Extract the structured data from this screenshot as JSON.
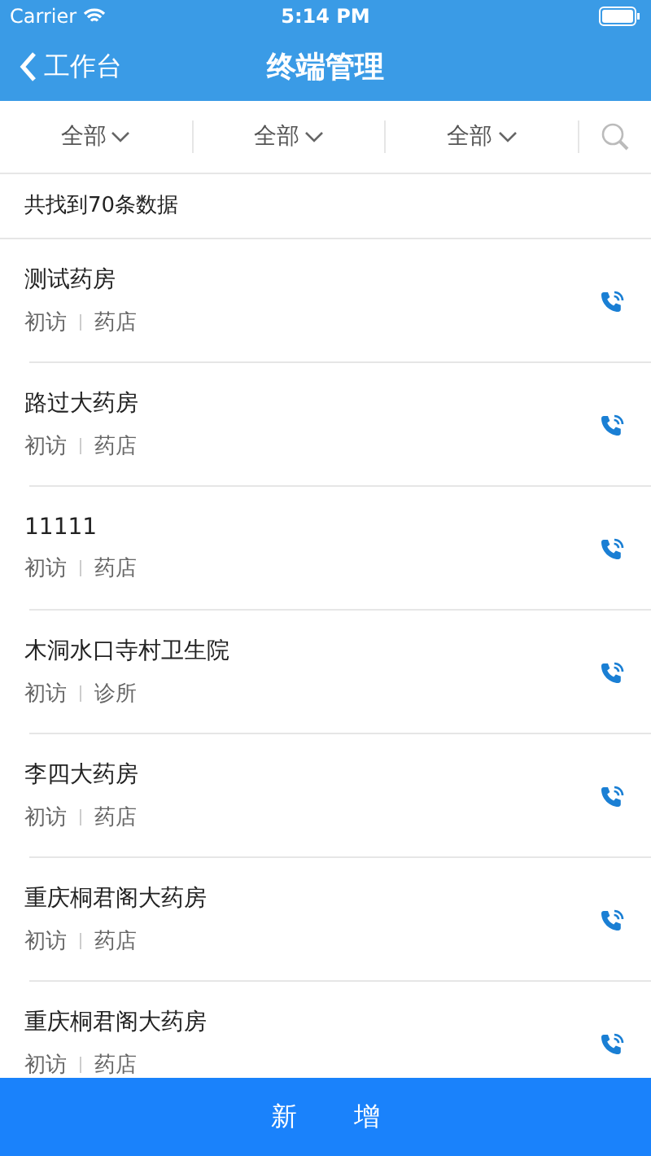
{
  "status_bar": {
    "carrier": "Carrier",
    "time": "5:14 PM"
  },
  "nav": {
    "back": "工作台",
    "title": "终端管理"
  },
  "filters": [
    {
      "label": "全部"
    },
    {
      "label": "全部"
    },
    {
      "label": "全部"
    }
  ],
  "count": "共找到70条数据",
  "rows": [
    {
      "name": "测试药房",
      "visit": "初访",
      "type": "药店"
    },
    {
      "name": "路过大药房",
      "visit": "初访",
      "type": "药店"
    },
    {
      "name": "11111",
      "visit": "初访",
      "type": "药店"
    },
    {
      "name": "木洞水口寺村卫生院",
      "visit": "初访",
      "type": "诊所"
    },
    {
      "name": "李四大药房",
      "visit": "初访",
      "type": "药店"
    },
    {
      "name": "重庆桐君阁大药房",
      "visit": "初访",
      "type": "药店"
    },
    {
      "name": "重庆桐君阁大药房",
      "visit": "初访",
      "type": "药店"
    }
  ],
  "add_button": "新 增"
}
